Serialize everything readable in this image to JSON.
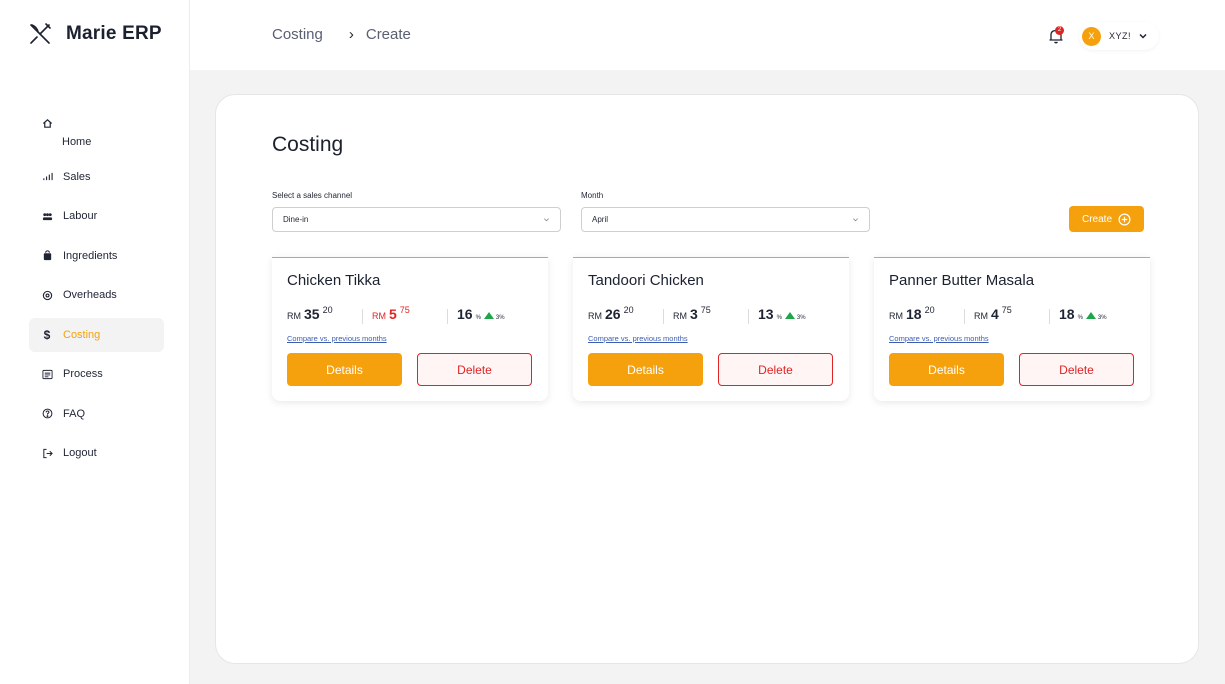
{
  "brand": {
    "name": "Marie ERP"
  },
  "sidebar": {
    "items": [
      {
        "label": "Home",
        "icon": "home-icon"
      },
      {
        "label": "Sales",
        "icon": "chart-icon"
      },
      {
        "label": "Labour",
        "icon": "users-icon"
      },
      {
        "label": "Ingredients",
        "icon": "bag-icon"
      },
      {
        "label": "Overheads",
        "icon": "gear-icon"
      },
      {
        "label": "Costing",
        "icon": "dollar-icon",
        "active": true
      },
      {
        "label": "Process",
        "icon": "list-icon"
      },
      {
        "label": "FAQ",
        "icon": "help-icon"
      },
      {
        "label": "Logout",
        "icon": "logout-icon"
      }
    ]
  },
  "header": {
    "breadcrumb": [
      "Costing",
      "Create"
    ],
    "notification_count": "2",
    "user": {
      "initial": "X",
      "name": "XYZ!"
    }
  },
  "main": {
    "title": "Costing",
    "channel": {
      "label": "Select a sales channel",
      "value": "Dine-in"
    },
    "month": {
      "label": "Month",
      "value": "April"
    },
    "create_label": "Create",
    "cards": [
      {
        "title": "Chicken Tikka",
        "price_main": "35",
        "price_cents": "20",
        "cost_main": "5",
        "cost_cents": "75",
        "percent": "16",
        "trend": "3%"
      },
      {
        "title": "Tandoori Chicken",
        "price_main": "26",
        "price_cents": "20",
        "cost_main": "3",
        "cost_cents": "75",
        "percent": "13",
        "trend": "3%"
      },
      {
        "title": "Panner Butter Masala",
        "price_main": "18",
        "price_cents": "20",
        "cost_main": "4",
        "cost_cents": "75",
        "percent": "18",
        "trend": "3%"
      }
    ],
    "currency": "RM",
    "percent_symbol": "%",
    "compare_label": "Compare vs. previous months",
    "details_label": "Details",
    "delete_label": "Delete"
  },
  "colors": {
    "accent": "#f5a10e",
    "danger": "#e02424",
    "positive": "#1fa64a",
    "link": "#3a5db3"
  }
}
